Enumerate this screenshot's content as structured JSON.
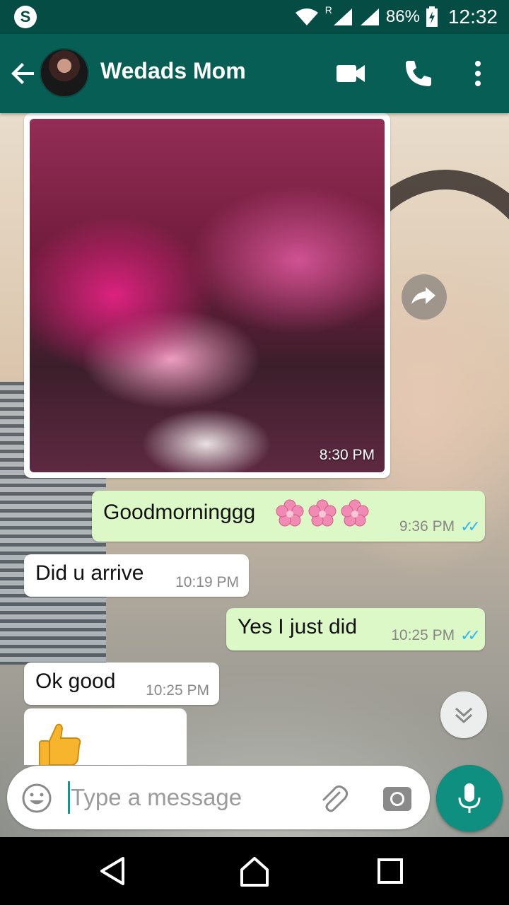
{
  "status_bar": {
    "app_icon": "skype-icon",
    "app_icon_letter": "S",
    "wifi": "wifi-icon",
    "signal_roaming": "R",
    "battery": "86%",
    "time": "12:32"
  },
  "header": {
    "contact_name": "Wedads Mom",
    "icons": [
      "back-arrow-icon",
      "video-call-icon",
      "phone-icon",
      "more-vert-icon"
    ]
  },
  "messages": [
    {
      "type": "image",
      "direction": "in",
      "time": "8:30 PM"
    },
    {
      "type": "text",
      "direction": "out",
      "text": "Goodmorninggg",
      "emoji": "cherry-blossom x3",
      "time": "9:36 PM",
      "status": "read"
    },
    {
      "type": "text",
      "direction": "in",
      "text": "Did u arrive",
      "time": "10:19 PM"
    },
    {
      "type": "text",
      "direction": "out",
      "text": "Yes I just did",
      "time": "10:25 PM",
      "status": "read"
    },
    {
      "type": "text",
      "direction": "in",
      "text": "Ok good",
      "time": "10:25 PM"
    },
    {
      "type": "emoji",
      "direction": "in",
      "emoji": "thumbs-up"
    }
  ],
  "composer": {
    "placeholder": "Type a message"
  },
  "colors": {
    "status_bar": "#054d44",
    "header": "#075e54",
    "outgoing_bubble": "#dcf8c6",
    "incoming_bubble": "#ffffff",
    "read_ticks": "#34b7f1",
    "mic_button": "#0e8f7f"
  }
}
